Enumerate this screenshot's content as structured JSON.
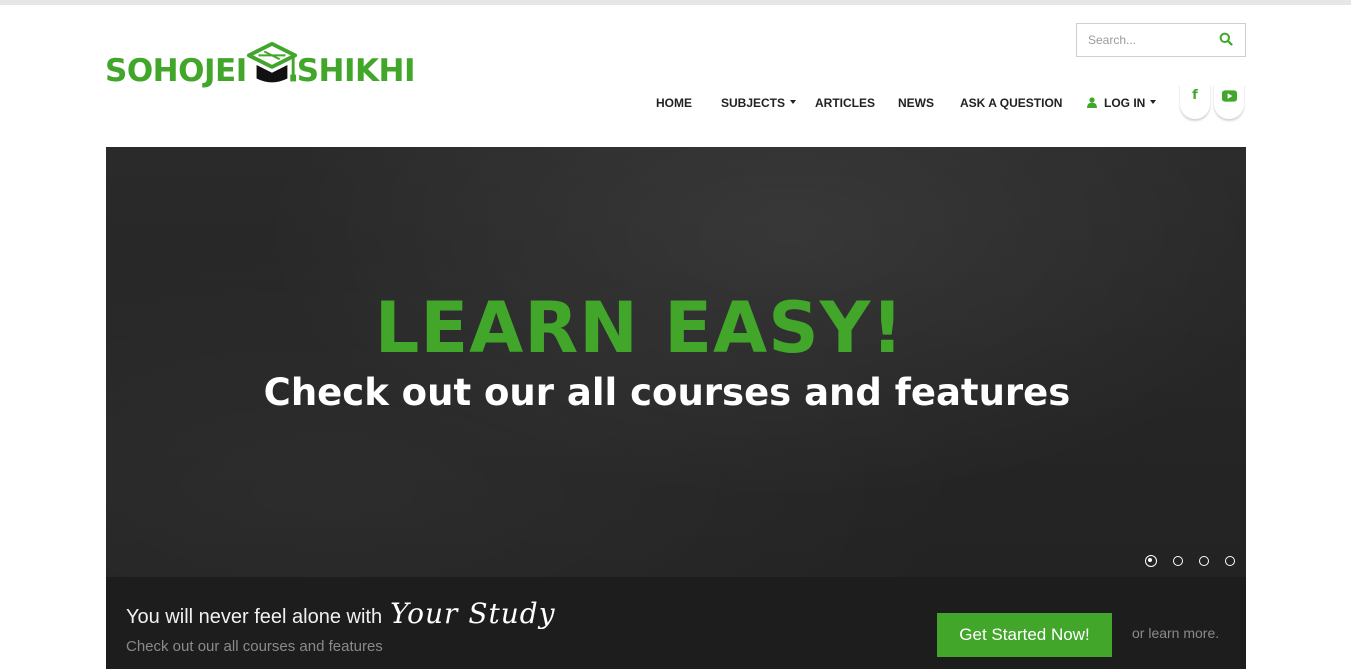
{
  "logo": {
    "left_text": "SOHOJEI",
    "right_text": "SHIKHI",
    "icon": "graduation-cap-icon"
  },
  "search": {
    "placeholder": "Search...",
    "icon": "search-icon"
  },
  "nav": {
    "items": [
      {
        "label": "HOME",
        "dropdown": false
      },
      {
        "label": "SUBJECTS",
        "dropdown": true
      },
      {
        "label": "ARTICLES",
        "dropdown": false
      },
      {
        "label": "NEWS",
        "dropdown": false
      },
      {
        "label": "ASK A QUESTION",
        "dropdown": false
      },
      {
        "label": "LOG IN",
        "dropdown": true,
        "icon": "user-icon"
      }
    ]
  },
  "social": [
    {
      "name": "facebook-icon",
      "glyph": "f"
    },
    {
      "name": "youtube-icon",
      "glyph": "▶"
    }
  ],
  "hero": {
    "title": "LEARN EASY!",
    "subtitle": "Check out our all courses and features",
    "slides": 4,
    "active_slide": 1
  },
  "promo": {
    "tagline": "You will never feel alone with",
    "tagline_script": "Your Study",
    "subtext": "Check out our all courses and features",
    "cta_label": "Get Started Now!",
    "learn_more": "or learn more."
  },
  "colors": {
    "accent": "#41a62a",
    "hero_bg": "#262626",
    "bar_bg": "#1d1d1d"
  }
}
